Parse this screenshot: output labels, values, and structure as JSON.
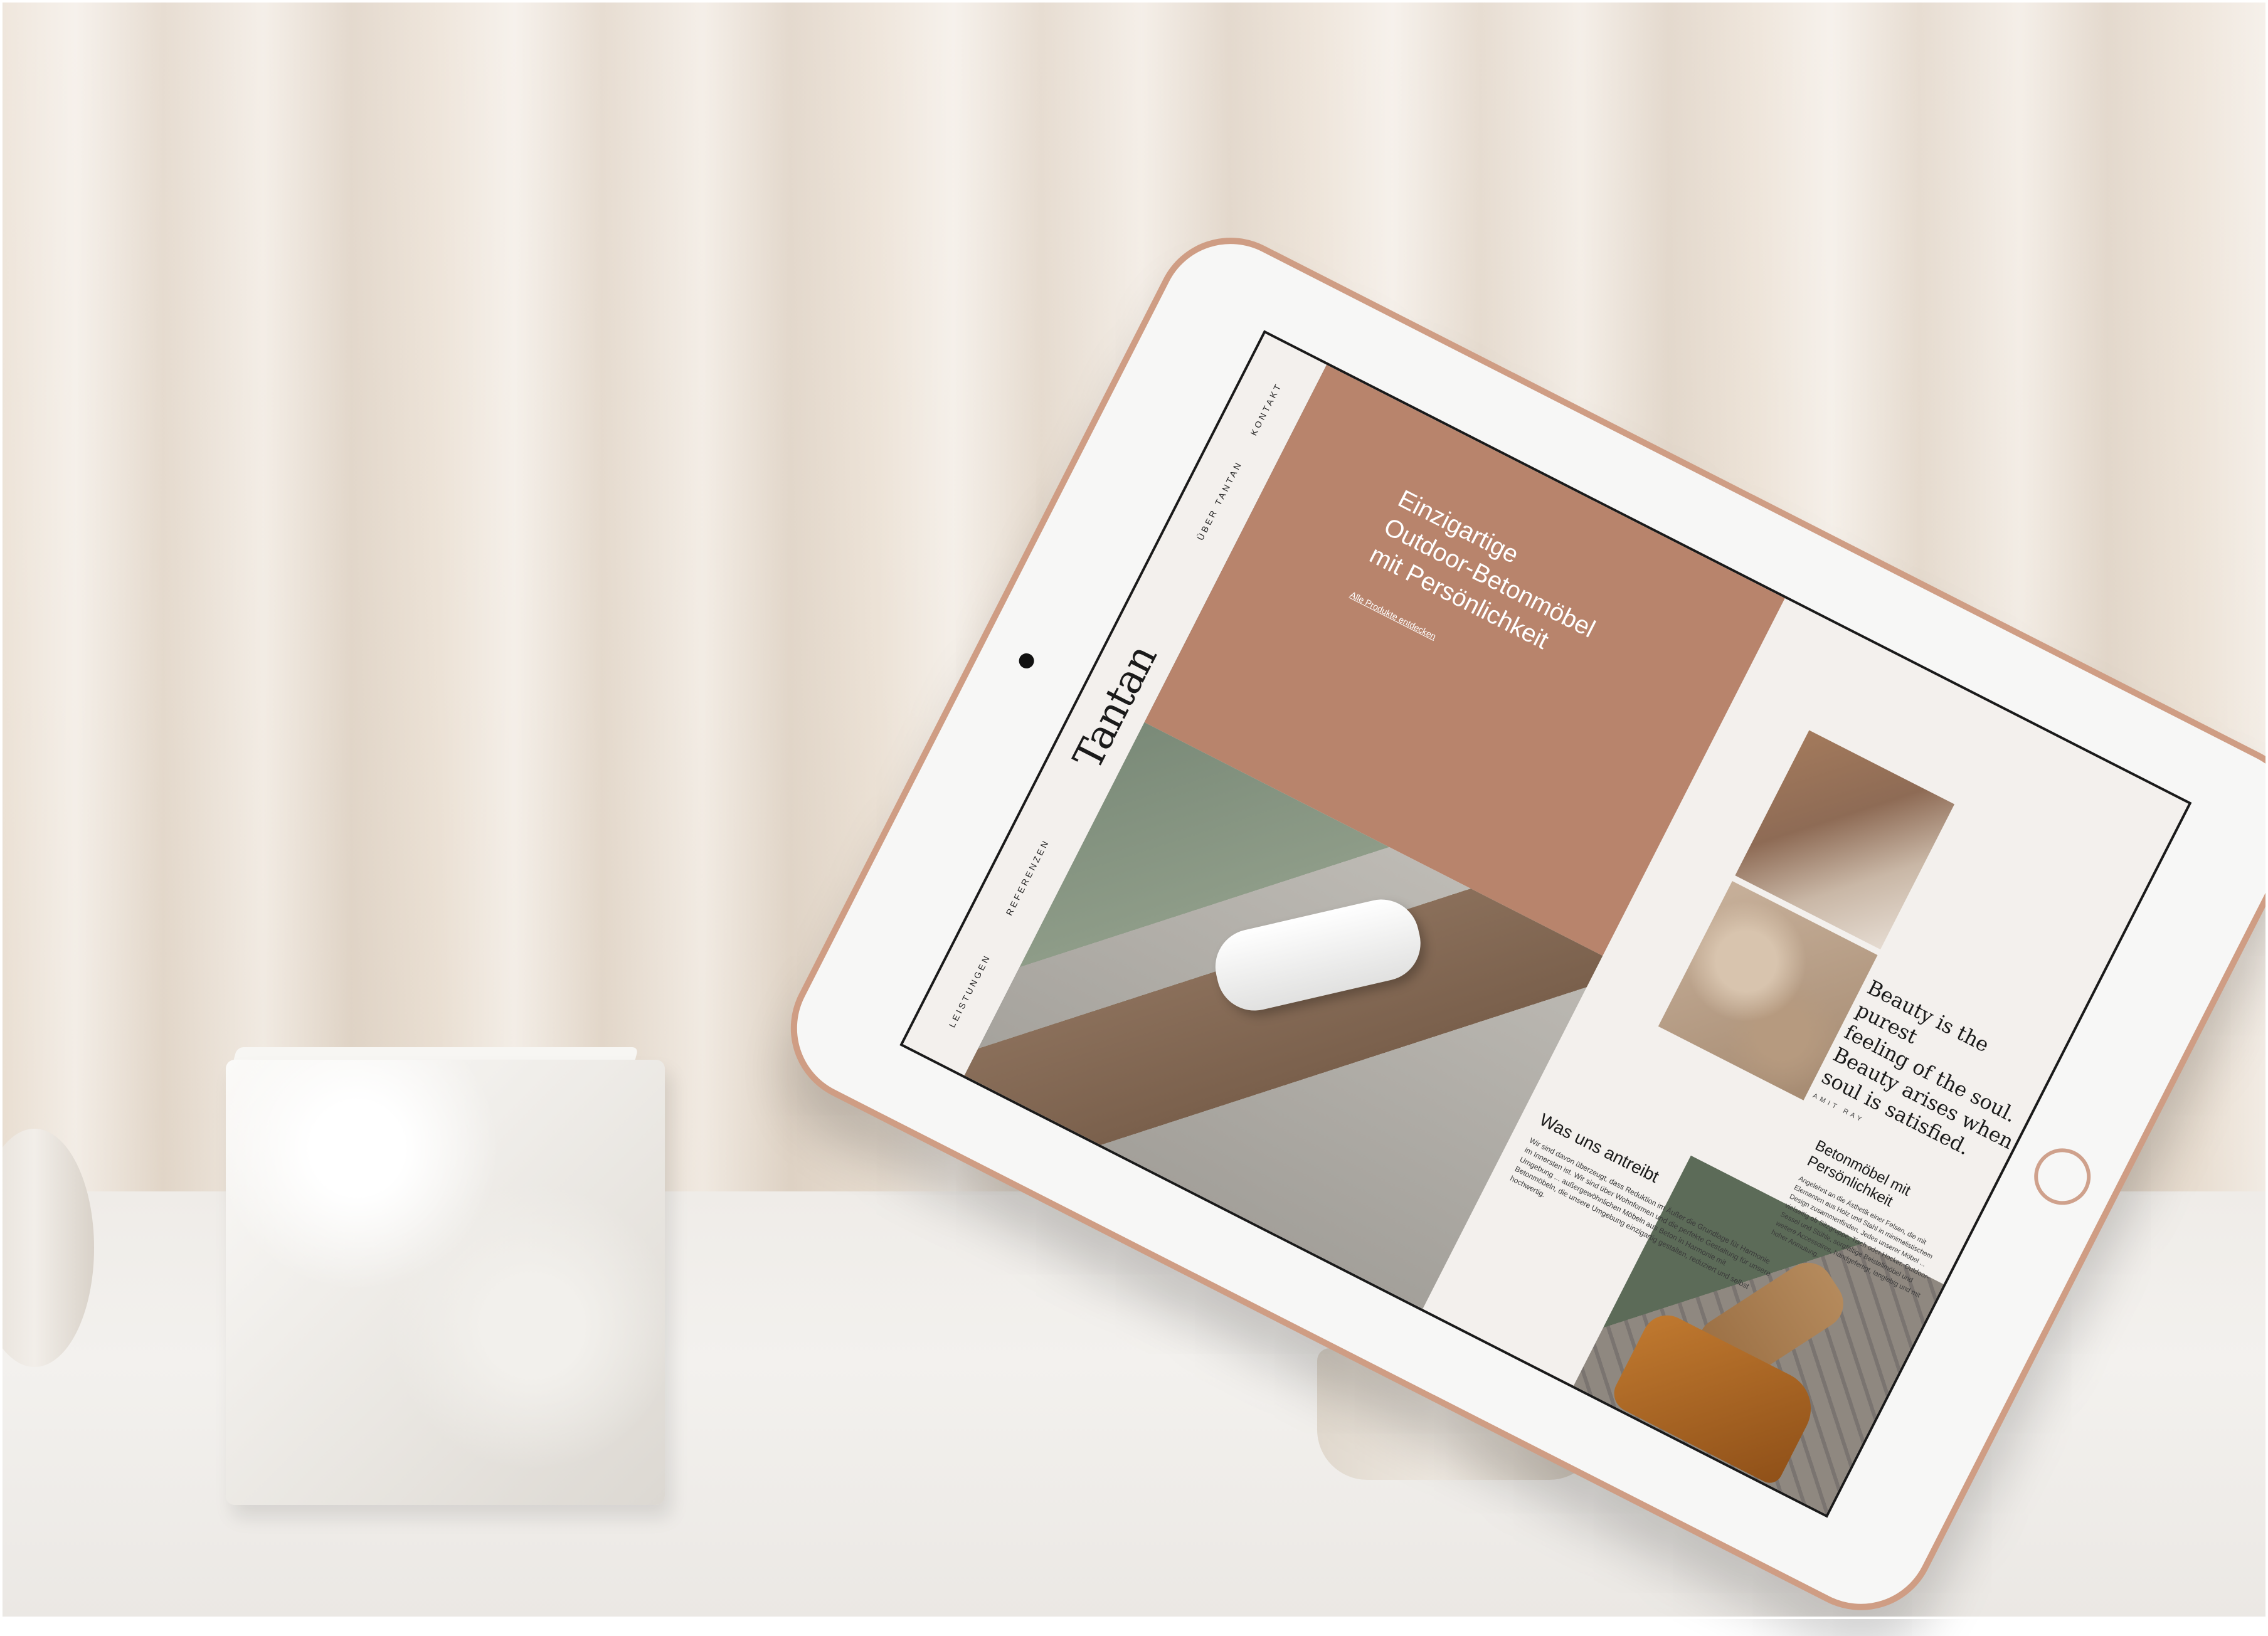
{
  "nav": {
    "leistungen": "LEISTUNGEN",
    "referenzen": "REFERENZEN",
    "ueber": "ÜBER TANTAN",
    "kontakt": "KONTAKT"
  },
  "brand": {
    "logo": "Tantan"
  },
  "hero": {
    "title_line1": "Einzigartige",
    "title_line2": "Outdoor-Betonmöbel",
    "title_line3": "mit Persönlichkeit",
    "link": "Alle Produkte entdecken"
  },
  "antrieb": {
    "heading": "Was uns antreibt",
    "body": "Wir sind davon überzeugt, dass Reduktion im Äußer die Grundlage für Harmonie im Innersten ist. Wir sind über Wohnformen und die perfekte Gestaltung für unsere Umgebung ... außergewöhnlichen Möbeln aus Beton in Harmonie mit Betonmöbeln, die unsere Umgebung einzigartig gestalten, reduziert und selbst hochwertig."
  },
  "quote": {
    "text_line1": "Beauty is the purest",
    "text_line2": "feeling of the soul.",
    "text_line3": "Beauty arises when",
    "text_line4": "soul is satisfied.",
    "author": "AMIT RAY"
  },
  "beton": {
    "heading": "Betonmöbel mit Persönlichkeit",
    "body": "Angelehnt an die Ästhetik einer Felsen, die mit Elementen aus Holz und Stahl in minimalistischem Design zusammenfinden. Jedes unserer Möbel ... vielseitig ob Sitzgruppe, Tisch oder Hocker. Outdoor-Sessel und Stühle, sorgfältige Beistellmöbel und weitere Accessoires, handgefertigt, langlebig und mit hoher Anmutung."
  },
  "colors": {
    "hero_bg": "#b8846c",
    "screen_bg": "#f3f0ed",
    "tablet_frame": "#cf9d84"
  },
  "icons": {
    "camera": "camera-dot",
    "home": "home-button-ring"
  }
}
